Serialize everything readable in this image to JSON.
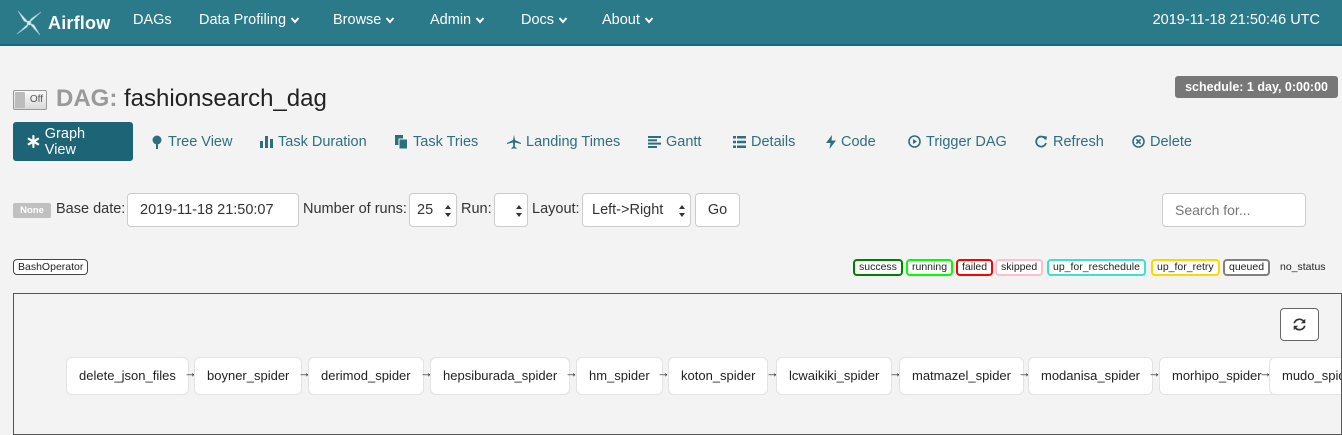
{
  "navbar": {
    "brand": "Airflow",
    "items": [
      {
        "label": "DAGs",
        "dropdown": false
      },
      {
        "label": "Data Profiling",
        "dropdown": true
      },
      {
        "label": "Browse",
        "dropdown": true
      },
      {
        "label": "Admin",
        "dropdown": true
      },
      {
        "label": "Docs",
        "dropdown": true
      },
      {
        "label": "About",
        "dropdown": true
      }
    ],
    "time": "2019-11-18 21:50:46 UTC"
  },
  "dag": {
    "toggle_label": "Off",
    "prefix": "DAG:",
    "name": "fashionsearch_dag",
    "schedule": "schedule: 1 day, 0:00:00"
  },
  "tabs": [
    {
      "label": "Graph View",
      "icon": "asterisk-icon",
      "active": true
    },
    {
      "label": "Tree View",
      "icon": "tree-icon"
    },
    {
      "label": "Task Duration",
      "icon": "bar-chart-icon"
    },
    {
      "label": "Task Tries",
      "icon": "duplicate-icon"
    },
    {
      "label": "Landing Times",
      "icon": "plane-icon"
    },
    {
      "label": "Gantt",
      "icon": "align-left-icon"
    },
    {
      "label": "Details",
      "icon": "list-icon"
    },
    {
      "label": "Code",
      "icon": "flash-icon"
    },
    {
      "label": "Trigger DAG",
      "icon": "play-circle-icon"
    },
    {
      "label": "Refresh",
      "icon": "refresh-icon"
    },
    {
      "label": "Delete",
      "icon": "remove-circle-icon"
    }
  ],
  "form": {
    "state_badge": "None",
    "base_date_label": "Base date:",
    "base_date_value": "2019-11-18 21:50:07",
    "num_runs_label": "Number of runs:",
    "num_runs_value": "25",
    "run_label": "Run:",
    "run_value": "",
    "layout_label": "Layout:",
    "layout_value": "Left->Right",
    "go_label": "Go",
    "search_placeholder": "Search for..."
  },
  "legend": {
    "operator": "BashOperator",
    "states": [
      {
        "label": "success",
        "color": "#008000"
      },
      {
        "label": "running",
        "color": "#00ff00"
      },
      {
        "label": "failed",
        "color": "#ff0000"
      },
      {
        "label": "skipped",
        "color": "#ffc0cb"
      },
      {
        "label": "up_for_reschedule",
        "color": "#40e0d0"
      },
      {
        "label": "up_for_retry",
        "color": "#ffd700"
      },
      {
        "label": "queued",
        "color": "#808080"
      },
      {
        "label": "no_status",
        "color": "#ffffff"
      }
    ]
  },
  "graph": {
    "arrow": "→",
    "nodes": [
      "delete_json_files",
      "boyner_spider",
      "derimod_spider",
      "hepsiburada_spider",
      "hm_spider",
      "koton_spider",
      "lcwaikiki_spider",
      "matmazel_spider",
      "modanisa_spider",
      "morhipo_spider",
      "mudo_spider"
    ]
  }
}
